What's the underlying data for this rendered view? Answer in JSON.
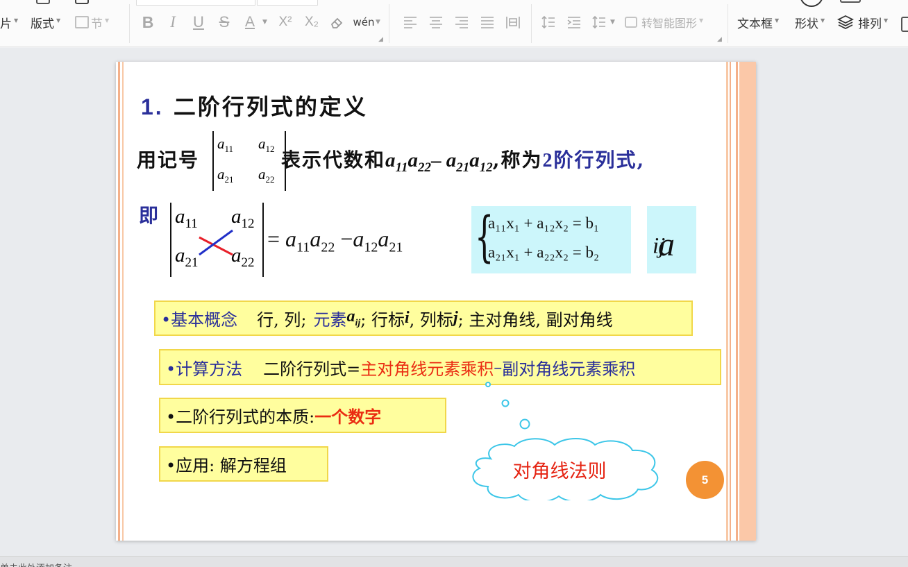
{
  "toolbar": {
    "partial_left": "片",
    "layout_label": "版式",
    "section_label": "节",
    "text_format": {
      "bold": "B",
      "italic": "I",
      "underline": "U",
      "strike": "S",
      "font_color": "A",
      "superscript": "X²",
      "subscript": "X₂",
      "eraser_icon": "eraser-icon",
      "pinyin": "wén"
    },
    "convert_smartart_label": "转智能图形",
    "textbox_label": "文本框",
    "shape_label": "形状",
    "arrange_label": "排列"
  },
  "status": {
    "text": "单击此处添加备注"
  },
  "slide": {
    "title_num": "1.",
    "title_text": "二阶行列式的定义",
    "line1": {
      "prefix": "用记号",
      "det": {
        "a11": "a",
        "s11": "11",
        "a12": "a",
        "s12": "12",
        "a21": "a",
        "s21": "21",
        "a22": "a",
        "s22": "22"
      },
      "mid": "表示代数和",
      "expr1": "a",
      "e1s": "11",
      "expr2": "a",
      "e2s": "22",
      "minus": "–",
      "expr3": "a",
      "e3s": "21",
      "expr4": "a",
      "e4s": "12",
      "comma": ",称为",
      "tail_num": "2",
      "tail_text": "阶行列式,"
    },
    "line2": {
      "ji": "即",
      "det": {
        "a11": "a",
        "s11": "11",
        "a12": "a",
        "s12": "12",
        "a21": "a",
        "s21": "21",
        "a22": "a",
        "s22": "22"
      },
      "eq": "=",
      "rhs1": "a",
      "r1s": "11",
      "rhs2": "a",
      "r2s": "22",
      "minus": "−",
      "rhs3": "a",
      "r3s": "12",
      "rhs4": "a",
      "r4s": "21"
    },
    "system": {
      "line1": "a₁₁x₁ + a₁₂x₂ = b₁",
      "line2": "a₂₁x₁ + a₂₂x₂ = b₂"
    },
    "aij": {
      "base": "a",
      "sub": "ij"
    },
    "boxes": {
      "basic": {
        "label": "•基本概念",
        "items_a": "行, 列;",
        "elem": "元素",
        "elem_sym": "a",
        "elem_sub": "ij",
        "items_b": "; 行标",
        "row_sym": "i",
        "items_c": ", 列标",
        "col_sym": "j",
        "items_d": "; 主对角线, 副对角线"
      },
      "method": {
        "label": "•计算方法",
        "desc": "二阶行列式=",
        "main": "主对角线元素乘积",
        "minus": "–",
        "sub": "副对角线元素乘积"
      },
      "essence": {
        "label": "•二阶行列式的本质: ",
        "value": "一个数字"
      },
      "app": {
        "label": "•应用: 解方程组"
      }
    },
    "callout": "对角线法则",
    "page_number": "5",
    "colors": {
      "blue": "#2a2f9a",
      "red": "#ea2c12",
      "yellow": "#fffe9e",
      "cyan": "#ccf6fb",
      "orange": "#f39234"
    }
  }
}
